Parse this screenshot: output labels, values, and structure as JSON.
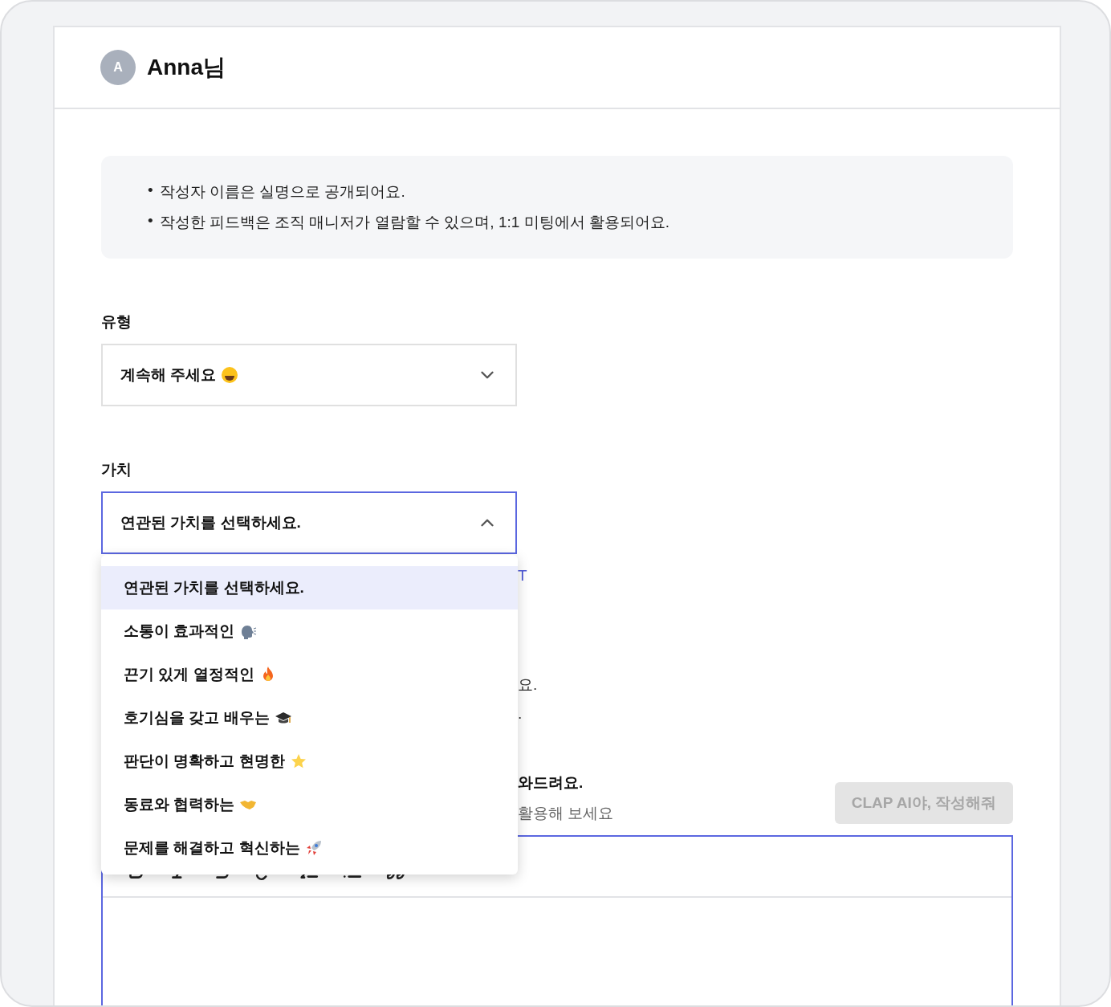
{
  "user": {
    "avatar_initial": "A",
    "name": "Anna님"
  },
  "notice": [
    {
      "bullet": "•",
      "text": "작성자 이름은 실명으로 공개되어요."
    },
    {
      "bullet": "•",
      "text": "작성한 피드백은 조직 매니저가 열람할 수 있으며, 1:1 미팅에서 활용되어요."
    }
  ],
  "type_field": {
    "label": "유형",
    "value": "계속해 주세요",
    "expanded": false
  },
  "value_field": {
    "label": "가치",
    "value": "연관된 가치를 선택하세요.",
    "expanded": true,
    "options": [
      {
        "label": "연관된 가치를 선택하세요.",
        "selected": true
      },
      {
        "label": "소통이 효과적인",
        "selected": false
      },
      {
        "label": "끈기 있게 열정적인",
        "selected": false
      },
      {
        "label": "호기심을 갖고 배우는",
        "selected": false
      },
      {
        "label": "판단이 명확하고 현명한",
        "selected": false
      },
      {
        "label": "동료와 협력하는",
        "selected": false
      },
      {
        "label": "문제를 해결하고 혁신하는",
        "selected": false
      }
    ]
  },
  "covered": {
    "link": "T",
    "line_1": "요.",
    "line_2": ".",
    "heading": "와드려요.",
    "hint": "활용해 보세요"
  },
  "ai_button": {
    "label": "CLAP AI야, 작성해줘",
    "disabled": true
  }
}
